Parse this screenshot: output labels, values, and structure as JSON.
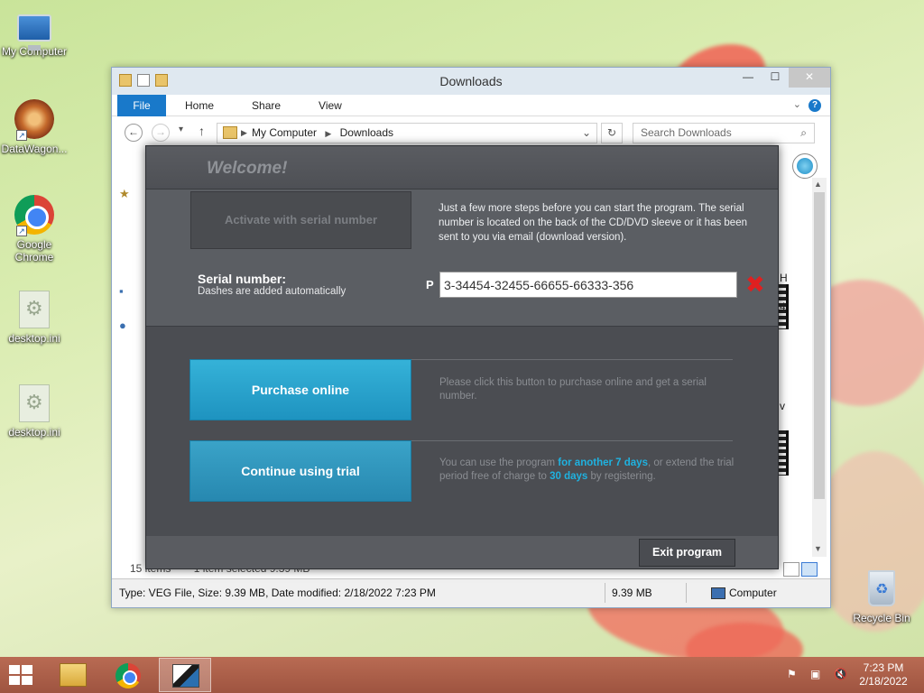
{
  "desktop": {
    "icons": [
      {
        "label": "My Computer"
      },
      {
        "label": "DataWagon..."
      },
      {
        "label": "Google Chrome"
      },
      {
        "label": "desktop.ini"
      },
      {
        "label": "desktop.ini"
      }
    ],
    "recycle_bin": "Recycle Bin"
  },
  "explorer": {
    "title": "Downloads",
    "window_buttons": {
      "minimize": "—",
      "maximize": "☐",
      "close": "✕"
    },
    "ribbon": {
      "file": "File",
      "tabs": [
        "Home",
        "Share",
        "View"
      ],
      "help": "?"
    },
    "address": {
      "crumbs": [
        "My Computer",
        "Downloads"
      ]
    },
    "search_placeholder": "Search Downloads",
    "status_items": "15 items",
    "status_selected": "1 item selected  9.39 MB",
    "side_labels": [
      "H",
      "4",
      "v"
    ],
    "statusbar": {
      "details": "Type: VEG File, Size: 9.39 MB, Date modified: 2/18/2022 7:23 PM",
      "size": "9.39 MB",
      "location": "Computer"
    }
  },
  "dialog": {
    "welcome": "Welcome!",
    "activate_button": "Activate with serial number",
    "activate_desc": "Just a few more steps before you can start the program. The serial number is located on the back of the CD/DVD sleeve or it has been sent to you via email (download version).",
    "serial_label": "Serial number:",
    "serial_sub": "Dashes are added automatically",
    "serial_prefix": "P",
    "serial_value": "3-34454-32455-66655-66333-356",
    "purchase_button": "Purchase online",
    "purchase_desc": "Please click this button to purchase online and get a serial number.",
    "trial_button": "Continue using trial",
    "trial_desc": {
      "a": "You can use the program ",
      "b": "for another 7 days",
      "c": ", or extend the trial period free of charge to ",
      "d": "30 days",
      "e": " by registering."
    },
    "exit_button": "Exit program"
  },
  "taskbar": {
    "clock_time": "7:23 PM",
    "clock_date": "2/18/2022"
  },
  "colors": {
    "accent_blue": "#1e93c0",
    "highlight": "#1fb2e0",
    "dialog_bg": "#4b4d52",
    "taskbar": "#a85a45"
  }
}
